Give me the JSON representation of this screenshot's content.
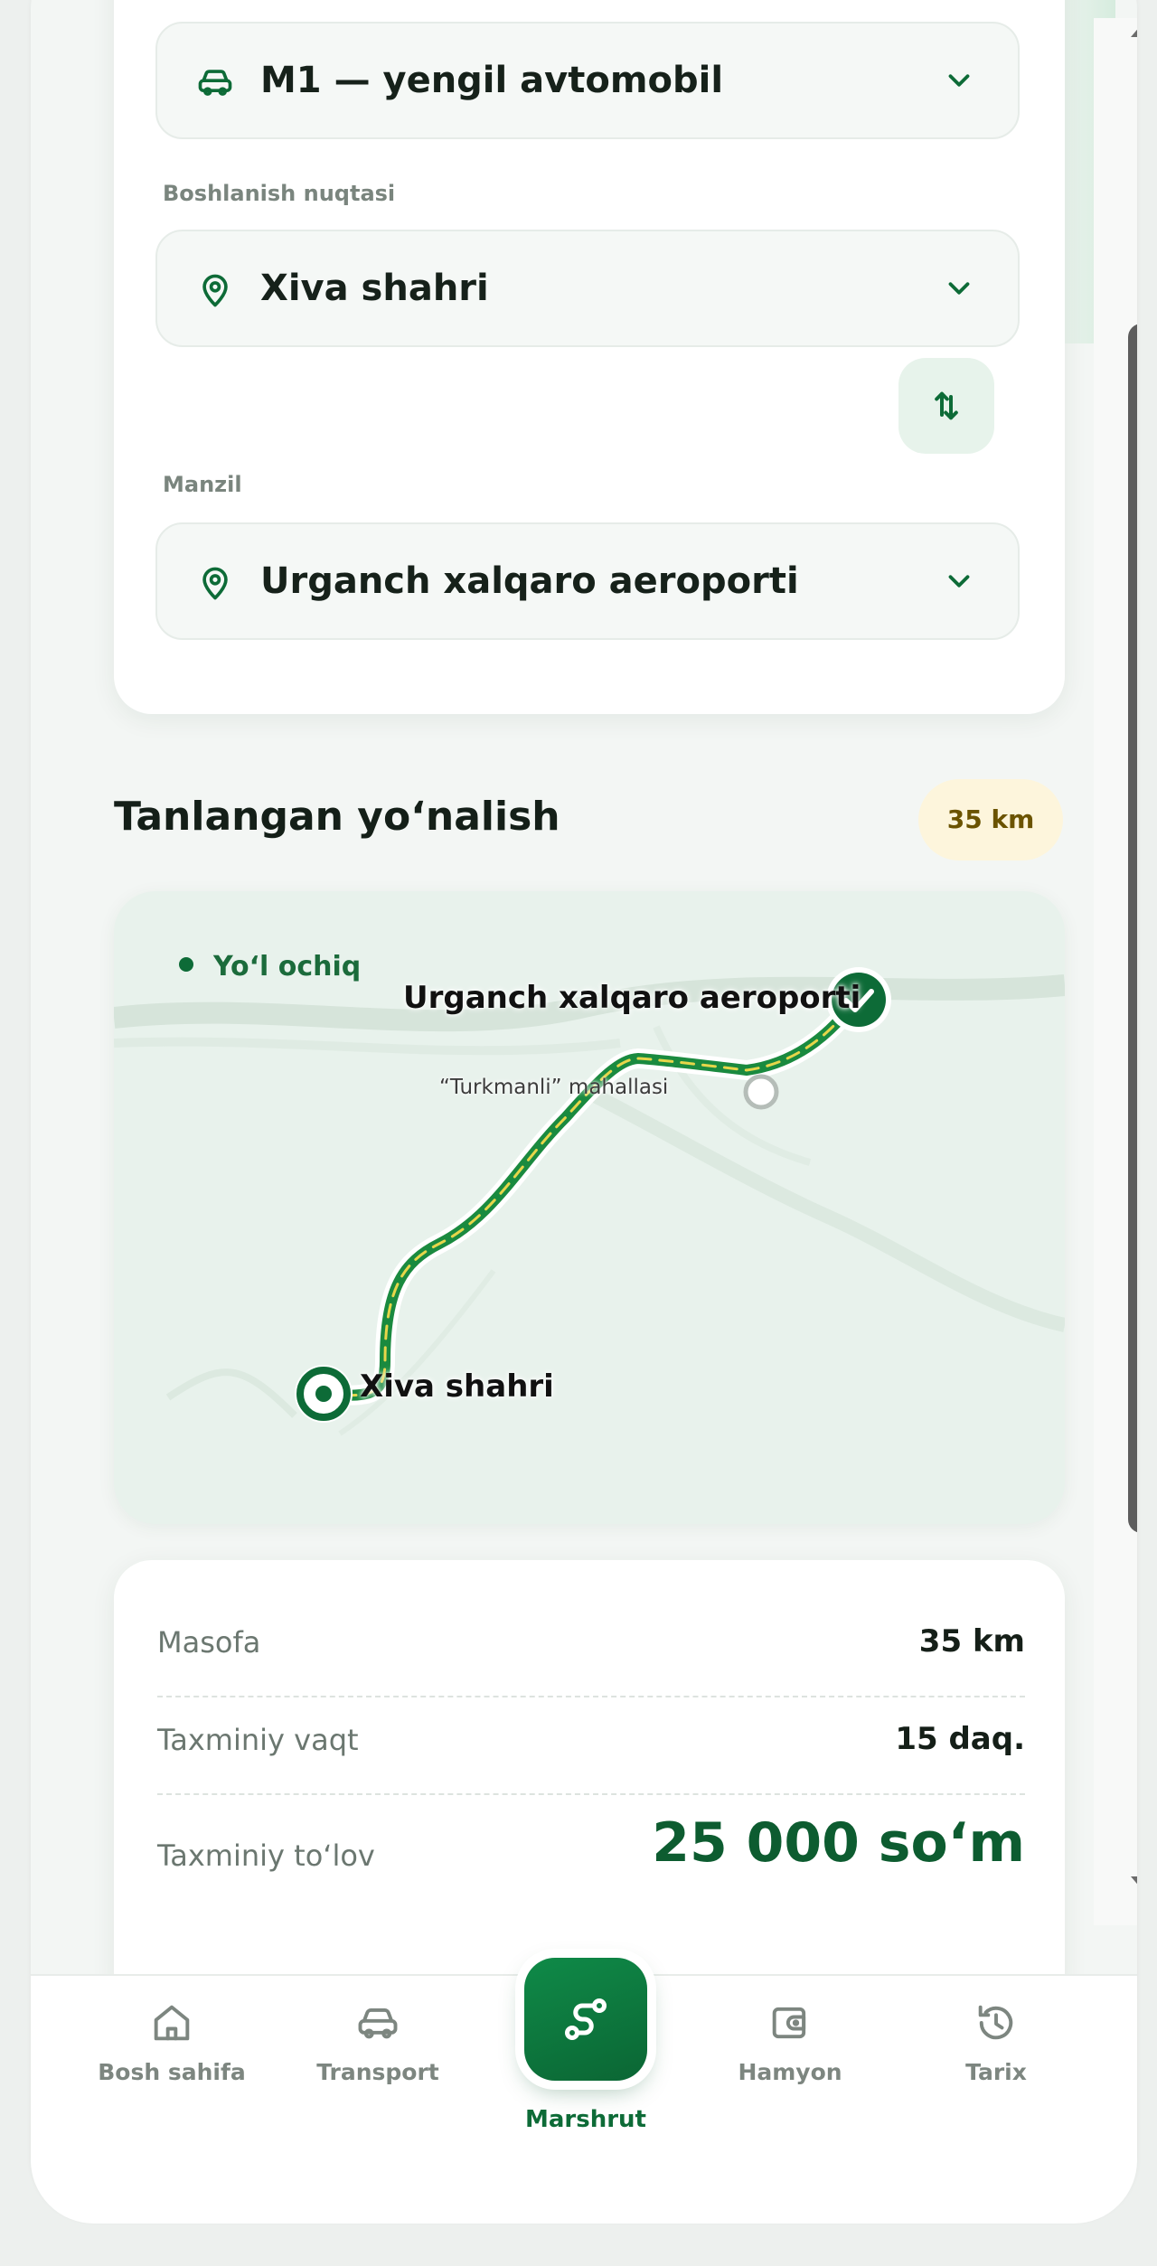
{
  "vehicle": {
    "value": "M1 — yengil avtomobil",
    "icon": "car-icon"
  },
  "start": {
    "label": "Boshlanish nuqtasi",
    "value": "Xiva shahri",
    "icon": "location-pin-icon"
  },
  "destination": {
    "label": "Manzil",
    "value": "Urganch xalqaro aeroporti",
    "icon": "location-pin-icon"
  },
  "swap": {
    "icon": "swap-vertical-icon"
  },
  "route": {
    "title": "Tanlangan yo‘nalish",
    "distance_badge": "35 km",
    "map": {
      "status": "Yo‘l ochiq",
      "dest_label": "Urganch xalqaro aeroporti",
      "waypoint_label": "“Turkmanli” mahallasi",
      "start_label": "Xiva shahri"
    }
  },
  "summary": {
    "distance_label": "Masofa",
    "distance_value": "35 km",
    "time_label": "Taxminiy vaqt",
    "time_value": "15 daq.",
    "price_label": "Taxminiy to‘lov",
    "price_value": "25 000 so‘m"
  },
  "nav": {
    "home": "Bosh sahifa",
    "transport": "Transport",
    "route": "Marshrut",
    "wallet": "Hamyon",
    "history": "Tarix"
  },
  "colors": {
    "accent": "#0d6b37",
    "route_line": "#1a8a3f",
    "route_dash": "#e6d64a",
    "badge_bg": "#fdf5dc"
  }
}
